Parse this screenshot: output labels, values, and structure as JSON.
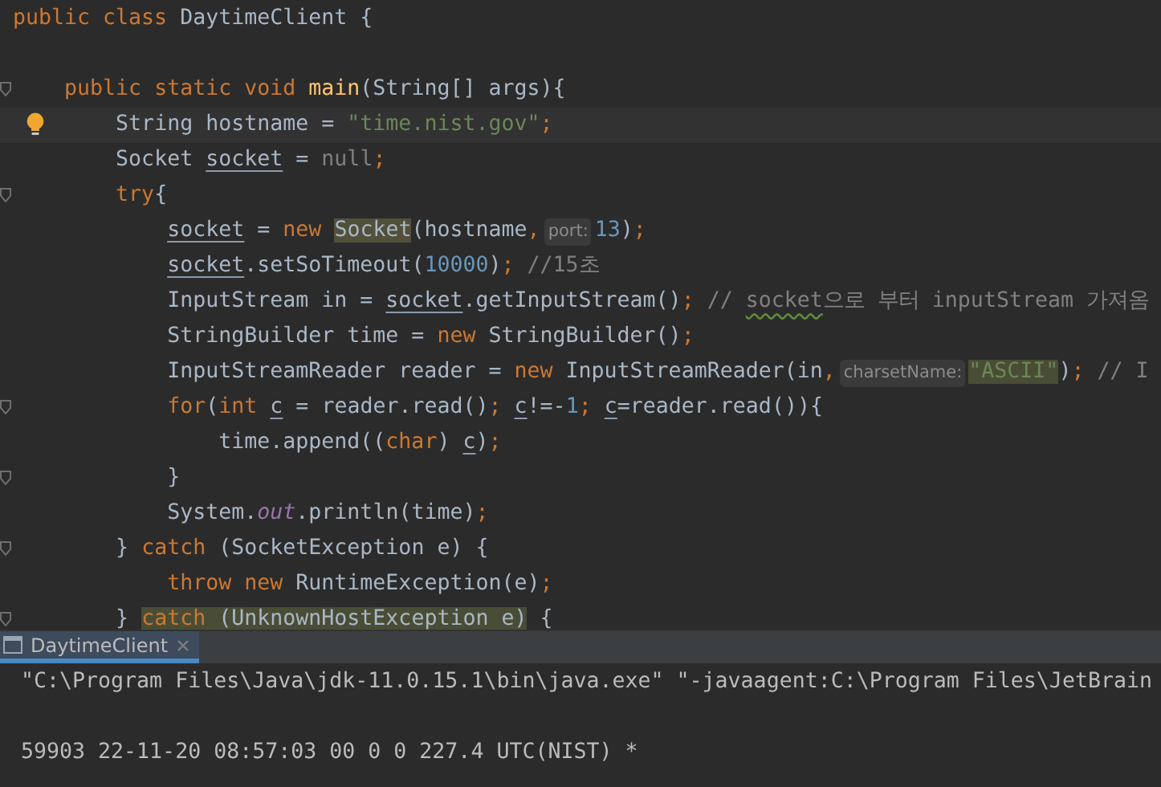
{
  "editor": {
    "lines": [
      {
        "tokens": [
          {
            "text": "public class ",
            "kind": "kw"
          },
          {
            "text": "DaytimeClient {",
            "kind": "plain"
          }
        ]
      },
      {
        "fold": true,
        "blank_before": true,
        "tokens": [
          {
            "text": "    public static void ",
            "kind": "kw"
          },
          {
            "text": "main",
            "kind": "decl"
          },
          {
            "text": "(String[] args){",
            "kind": "plain"
          }
        ]
      },
      {
        "current": true,
        "bulb": true,
        "tokens": [
          {
            "text": "        String hostname = ",
            "kind": "plain"
          },
          {
            "text": "\"time.nist.gov\"",
            "kind": "str"
          },
          {
            "text": ";",
            "kind": "kw"
          }
        ]
      },
      {
        "tokens": [
          {
            "text": "        Socket ",
            "kind": "plain"
          },
          {
            "text": "socket",
            "kind": "var"
          },
          {
            "text": " = ",
            "kind": "plain"
          },
          {
            "text": "null",
            "kind": "comment"
          },
          {
            "text": ";",
            "kind": "kw"
          }
        ]
      },
      {
        "fold": true,
        "tokens": [
          {
            "text": "        try",
            "kind": "kw"
          },
          {
            "text": "{",
            "kind": "plain"
          }
        ]
      },
      {
        "tokens": [
          {
            "text": "            socket",
            "kind": "var"
          },
          {
            "text": " = ",
            "kind": "plain"
          },
          {
            "text": "new ",
            "kind": "kw"
          },
          {
            "text": "Socket",
            "kind": "usage"
          },
          {
            "text": "(hostname",
            "kind": "plain"
          },
          {
            "text": ",",
            "kind": "kw"
          },
          {
            "text": "port:",
            "kind": "hint"
          },
          {
            "text": "13",
            "kind": "num"
          },
          {
            "text": ")",
            "kind": "plain"
          },
          {
            "text": ";",
            "kind": "kw"
          }
        ]
      },
      {
        "tokens": [
          {
            "text": "            socket",
            "kind": "var"
          },
          {
            "text": ".setSoTimeout(",
            "kind": "plain"
          },
          {
            "text": "10000",
            "kind": "num"
          },
          {
            "text": ")",
            "kind": "plain"
          },
          {
            "text": "; ",
            "kind": "kw"
          },
          {
            "text": "//15초",
            "kind": "comment"
          }
        ]
      },
      {
        "tokens": [
          {
            "text": "            InputStream in = ",
            "kind": "plain"
          },
          {
            "text": "socket",
            "kind": "var"
          },
          {
            "text": ".getInputStream()",
            "kind": "plain"
          },
          {
            "text": "; ",
            "kind": "kw"
          },
          {
            "text": "// ",
            "kind": "comment"
          },
          {
            "text": "socket",
            "kind": "typo"
          },
          {
            "text": "으로 부터 inputStream 가져옴",
            "kind": "comment"
          }
        ]
      },
      {
        "tokens": [
          {
            "text": "            StringBuilder time = ",
            "kind": "plain"
          },
          {
            "text": "new ",
            "kind": "kw"
          },
          {
            "text": "StringBuilder()",
            "kind": "plain"
          },
          {
            "text": ";",
            "kind": "kw"
          }
        ]
      },
      {
        "tokens": [
          {
            "text": "            InputStreamReader reader = ",
            "kind": "plain"
          },
          {
            "text": "new ",
            "kind": "kw"
          },
          {
            "text": "InputStreamReader(in",
            "kind": "plain"
          },
          {
            "text": ",",
            "kind": "kw"
          },
          {
            "text": "charsetName:",
            "kind": "hint"
          },
          {
            "text": "\"ASCII\"",
            "kind": "strhl"
          },
          {
            "text": ")",
            "kind": "plain"
          },
          {
            "text": "; ",
            "kind": "kw"
          },
          {
            "text": "// I",
            "kind": "comment"
          }
        ]
      },
      {
        "fold": true,
        "tokens": [
          {
            "text": "            for",
            "kind": "kw"
          },
          {
            "text": "(",
            "kind": "plain"
          },
          {
            "text": "int ",
            "kind": "kw"
          },
          {
            "text": "c",
            "kind": "var"
          },
          {
            "text": " = reader.read()",
            "kind": "plain"
          },
          {
            "text": "; ",
            "kind": "kw"
          },
          {
            "text": "c",
            "kind": "var"
          },
          {
            "text": "!=-",
            "kind": "plain"
          },
          {
            "text": "1",
            "kind": "num"
          },
          {
            "text": "; ",
            "kind": "kw"
          },
          {
            "text": "c",
            "kind": "var"
          },
          {
            "text": "=reader.read()){",
            "kind": "plain"
          }
        ]
      },
      {
        "tokens": [
          {
            "text": "                time.append((",
            "kind": "plain"
          },
          {
            "text": "char",
            "kind": "kw"
          },
          {
            "text": ") ",
            "kind": "plain"
          },
          {
            "text": "c",
            "kind": "var"
          },
          {
            "text": ")",
            "kind": "plain"
          },
          {
            "text": ";",
            "kind": "kw"
          }
        ]
      },
      {
        "fold": true,
        "tokens": [
          {
            "text": "            }",
            "kind": "plain"
          }
        ]
      },
      {
        "tokens": [
          {
            "text": "            System.",
            "kind": "plain"
          },
          {
            "text": "out",
            "kind": "field"
          },
          {
            "text": ".println(time)",
            "kind": "plain"
          },
          {
            "text": ";",
            "kind": "kw"
          }
        ]
      },
      {
        "fold": true,
        "tokens": [
          {
            "text": "        } ",
            "kind": "plain"
          },
          {
            "text": "catch ",
            "kind": "kw"
          },
          {
            "text": "(SocketException e) {",
            "kind": "plain"
          }
        ]
      },
      {
        "tokens": [
          {
            "text": "            throw new ",
            "kind": "kw"
          },
          {
            "text": "RuntimeException(e)",
            "kind": "plain"
          },
          {
            "text": ";",
            "kind": "kw"
          }
        ]
      },
      {
        "fold": true,
        "tokens": [
          {
            "text": "        } ",
            "kind": "plain"
          },
          {
            "text": "catch ",
            "kind": "kwhl"
          },
          {
            "text": "(UnknownHostException e)",
            "kind": "plainhl"
          },
          {
            "text": " {",
            "kind": "plain"
          }
        ]
      }
    ]
  },
  "run_panel": {
    "tab": {
      "label": "DaytimeClient",
      "selected": true
    },
    "console": [
      {
        "text": "\"C:\\Program Files\\Java\\jdk-11.0.15.1\\bin\\java.exe\" \"-javaagent:C:\\Program Files\\JetBrain"
      },
      {
        "blank_before": true,
        "text": "59903 22-11-20 08:57:03 00 0 0 227.4 UTC(NIST) *"
      }
    ]
  }
}
